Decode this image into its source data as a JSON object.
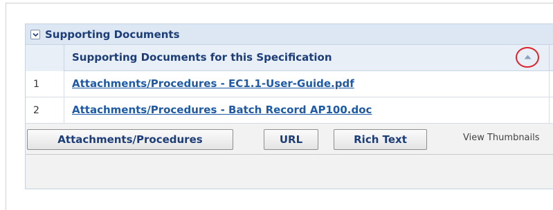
{
  "panel": {
    "title": "Supporting Documents",
    "column_header": "Supporting Documents for this Specification",
    "rows": [
      {
        "num": "1",
        "doc": "Attachments/Procedures - EC1.1-User-Guide.pdf"
      },
      {
        "num": "2",
        "doc": "Attachments/Procedures - Batch Record AP100.doc"
      }
    ]
  },
  "toolbar": {
    "attachments_label": "Attachments/Procedures",
    "url_label": "URL",
    "rich_text_label": "Rich Text",
    "view_thumbnails_label": "View Thumbnails"
  },
  "colors": {
    "header_bg": "#dce7f3",
    "title_text": "#1c3d78",
    "link": "#1f5aa6",
    "highlight_circle": "#e0212b"
  },
  "icons": {
    "collapse": "chevron-down-icon",
    "sort": "sort-ascending-icon"
  }
}
